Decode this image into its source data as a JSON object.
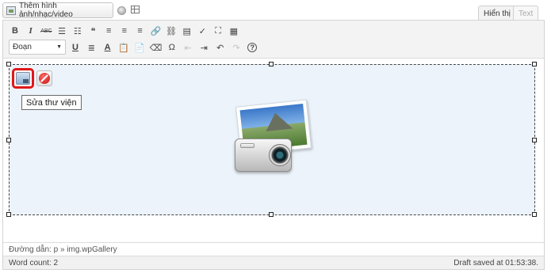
{
  "media_button": {
    "label": "Thêm hình ảnh/nhạc/video",
    "icon": "add-media-icon"
  },
  "tabs": [
    {
      "label": "Hiển thị",
      "active": true
    },
    {
      "label": "Text",
      "active": false
    }
  ],
  "toolbar": {
    "row1": [
      {
        "name": "bold",
        "glyph": "B"
      },
      {
        "name": "italic",
        "glyph": "I"
      },
      {
        "name": "strikethrough",
        "glyph": "ABC"
      },
      {
        "name": "bullet-list",
        "glyph": "☰"
      },
      {
        "name": "numbered-list",
        "glyph": "☷"
      },
      {
        "name": "blockquote",
        "glyph": "❝"
      },
      {
        "name": "align-left",
        "glyph": "≡"
      },
      {
        "name": "align-center",
        "glyph": "≡"
      },
      {
        "name": "align-right",
        "glyph": "≡"
      },
      {
        "name": "insert-link",
        "glyph": "🔗"
      },
      {
        "name": "unlink",
        "glyph": "⛓"
      },
      {
        "name": "insert-more",
        "glyph": "▤"
      },
      {
        "name": "spellcheck",
        "glyph": "✓"
      },
      {
        "name": "fullscreen",
        "glyph": "⛶"
      },
      {
        "name": "kitchen-sink",
        "glyph": "▦"
      }
    ],
    "format_select": {
      "value": "Đoạn"
    },
    "row2": [
      {
        "name": "underline",
        "glyph": "U",
        "disabled": false
      },
      {
        "name": "justify",
        "glyph": "≣",
        "disabled": false
      },
      {
        "name": "text-color",
        "glyph": "A",
        "disabled": false
      },
      {
        "name": "paste-text",
        "glyph": "📋",
        "disabled": false
      },
      {
        "name": "paste-word",
        "glyph": "📄",
        "disabled": false
      },
      {
        "name": "clear-format",
        "glyph": "⌫",
        "disabled": false
      },
      {
        "name": "special-char",
        "glyph": "Ω",
        "disabled": false
      },
      {
        "name": "outdent",
        "glyph": "⇤",
        "disabled": true
      },
      {
        "name": "indent",
        "glyph": "⇥",
        "disabled": false
      },
      {
        "name": "undo",
        "glyph": "↶",
        "disabled": false
      },
      {
        "name": "redo",
        "glyph": "↷",
        "disabled": true
      },
      {
        "name": "help",
        "glyph": "?",
        "disabled": false
      }
    ]
  },
  "gallery": {
    "tooltip": "Sửa thư viện",
    "edit_icon": "edit-gallery-icon",
    "delete_icon": "delete-gallery-icon",
    "placeholder_icon": "camera-photo-icon"
  },
  "path_bar": {
    "text": "Đường dẫn: p » img.wpGallery"
  },
  "status": {
    "word_count": "Word count: 2",
    "draft_saved": "Draft saved at 01:53:38."
  }
}
